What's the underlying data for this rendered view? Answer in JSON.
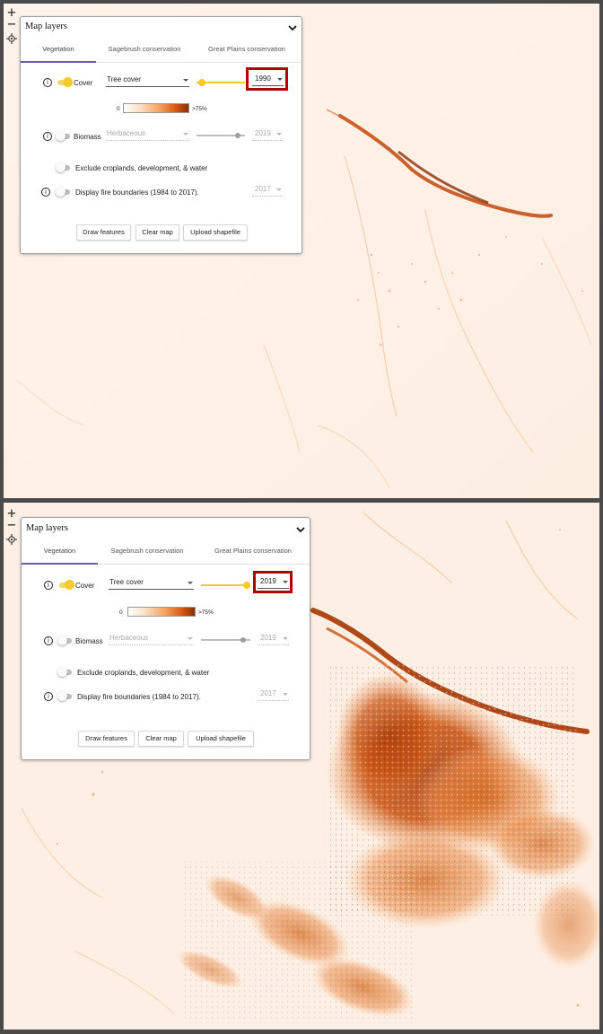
{
  "colors": {
    "accent_tab": "#6f5aa8",
    "toggle_on": "#f7c92d",
    "highlight": "#b00000",
    "legend_low": "#ffffff",
    "legend_high": "#8c2d04"
  },
  "zoom_controls": {
    "zoom_in": "+",
    "zoom_out": "−",
    "locate_icon": "crosshair-icon"
  },
  "screens": [
    {
      "panel": {
        "title": "Map layers",
        "collapse_icon": "chevron-down-icon",
        "tabs": [
          "Vegetation",
          "Sagebrush conservation",
          "Great Plains conservation"
        ],
        "active_tab": "Vegetation",
        "cover": {
          "label": "Cover",
          "enabled": true,
          "dropdown": "Tree cover",
          "year": "1990",
          "slider_fraction": 0.05
        },
        "legend": {
          "min": "0",
          "max": ">75%"
        },
        "biomass": {
          "label": "Biomass",
          "enabled": false,
          "dropdown": "Herbaceous",
          "year": "2019",
          "slider_fraction": 0.9
        },
        "exclude": {
          "label": "Exclude croplands, development, & water",
          "enabled": false
        },
        "fire": {
          "label": "Display fire boundaries (1984 to 2017).",
          "enabled": false,
          "year": "2017"
        },
        "buttons": [
          "Draw features",
          "Clear map",
          "Upload shapefile"
        ],
        "info_icon": "i"
      }
    },
    {
      "panel": {
        "title": "Map layers",
        "collapse_icon": "chevron-down-icon",
        "tabs": [
          "Vegetation",
          "Sagebrush conservation",
          "Great Plains conservation"
        ],
        "active_tab": "Vegetation",
        "cover": {
          "label": "Cover",
          "enabled": true,
          "dropdown": "Tree cover",
          "year": "2019",
          "slider_fraction": 1.0
        },
        "legend": {
          "min": "0",
          "max": ">75%"
        },
        "biomass": {
          "label": "Biomass",
          "enabled": false,
          "dropdown": "Herbaceous",
          "year": "2019",
          "slider_fraction": 0.9
        },
        "exclude": {
          "label": "Exclude croplands, development, & water",
          "enabled": false
        },
        "fire": {
          "label": "Display fire boundaries (1984 to 2017).",
          "enabled": false,
          "year": "2017"
        },
        "buttons": [
          "Draw features",
          "Clear map",
          "Upload shapefile"
        ],
        "info_icon": "i"
      }
    }
  ]
}
